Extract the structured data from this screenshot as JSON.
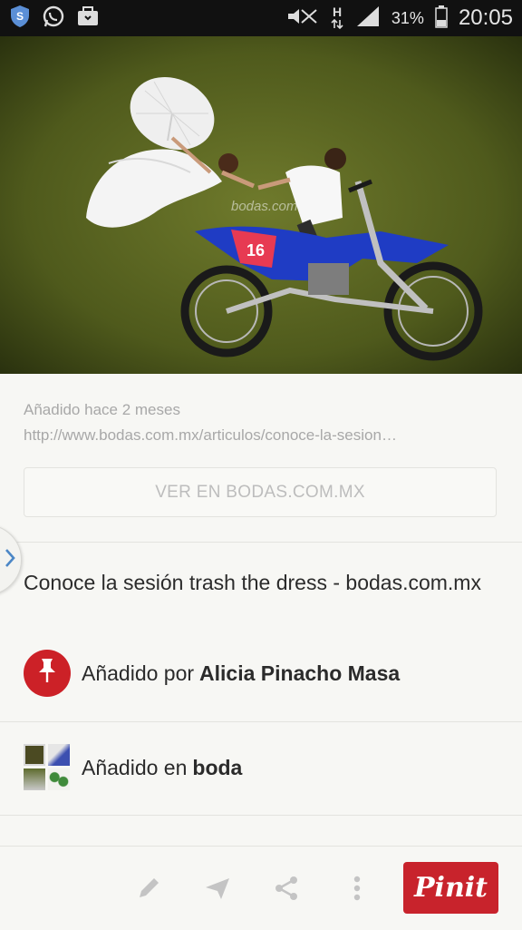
{
  "status_bar": {
    "battery": "31%",
    "time": "20:05"
  },
  "image": {
    "watermark": "bodas.com.mx"
  },
  "meta": {
    "added": "Añadido hace 2 meses",
    "url": "http://www.bodas.com.mx/articulos/conoce-la-sesion…"
  },
  "visit_button": "VER EN BODAS.COM.MX",
  "pin_title": "Conoce la sesión trash the dress - bodas.com.mx",
  "added_by": {
    "prefix": "Añadido por",
    "name": "Alicia Pinacho Masa"
  },
  "added_in": {
    "prefix": "Añadido en",
    "board": "boda"
  },
  "toolbar": {
    "pin_it": "Pinit"
  },
  "colors": {
    "pinterest_red": "#cc2127",
    "status_bar": "#111111"
  }
}
